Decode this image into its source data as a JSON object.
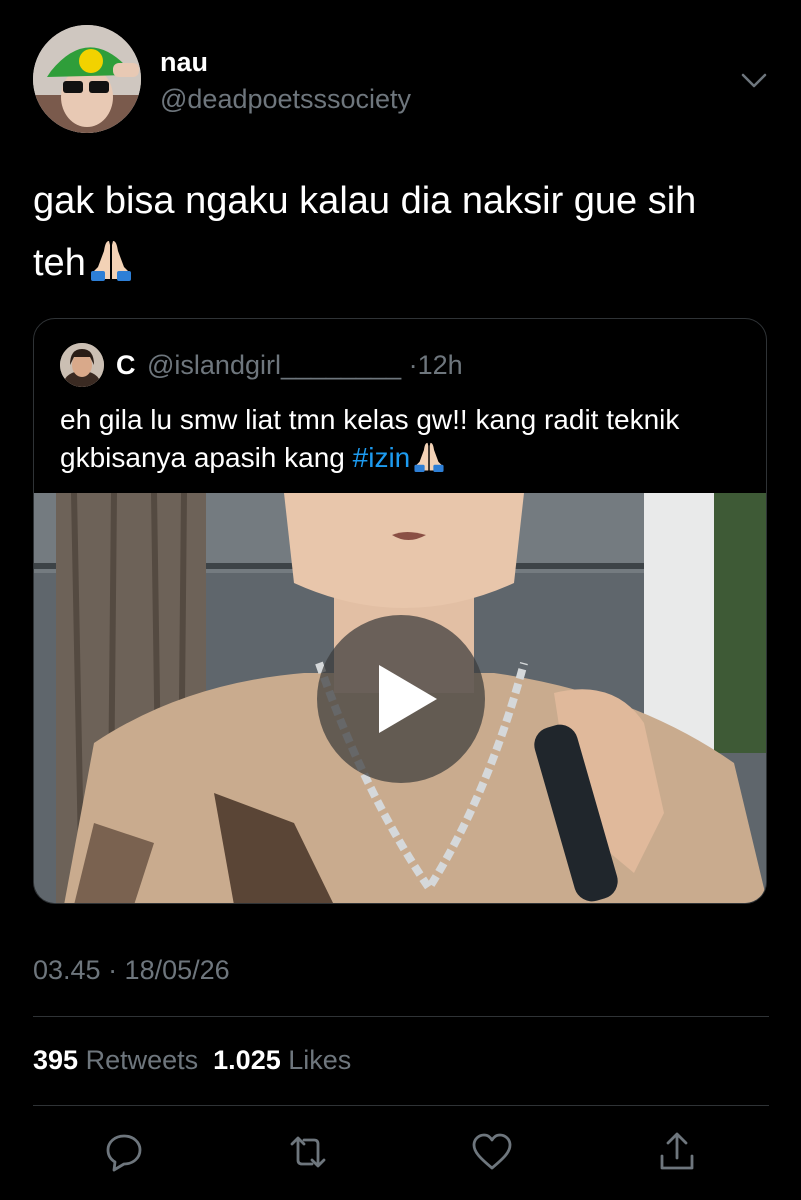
{
  "author": {
    "display_name": "nau",
    "handle": "@deadpoetsssociety",
    "avatar_icon": "profile-photo"
  },
  "tweet": {
    "text": "gak bisa ngaku kalau dia naksir gue sih teh",
    "emoji": "folded-hands"
  },
  "quoted_tweet": {
    "name": "C",
    "handle": "@islandgirl________",
    "separator": "·",
    "time": "12h",
    "text": "eh gila lu smw liat tmn kelas gw!! kang radit teknik gkbisanya apasih kang ",
    "hashtag": "#izin",
    "emoji": "folded-hands",
    "media": {
      "type": "video",
      "play_icon": "play-icon"
    }
  },
  "meta": {
    "timestamp": "03.45 · 18/05/26"
  },
  "stats": {
    "retweets_count": "395",
    "retweets_label": "Retweets",
    "likes_count": "1.025",
    "likes_label": "Likes"
  },
  "actions": [
    {
      "name": "reply",
      "icon": "reply-icon"
    },
    {
      "name": "retweet",
      "icon": "retweet-icon"
    },
    {
      "name": "like",
      "icon": "heart-icon"
    },
    {
      "name": "share",
      "icon": "share-icon"
    }
  ],
  "colors": {
    "background": "#000000",
    "text": "#ffffff",
    "secondary": "#6e767d",
    "hashtag": "#1d9bf0",
    "border": "#2f3336"
  }
}
